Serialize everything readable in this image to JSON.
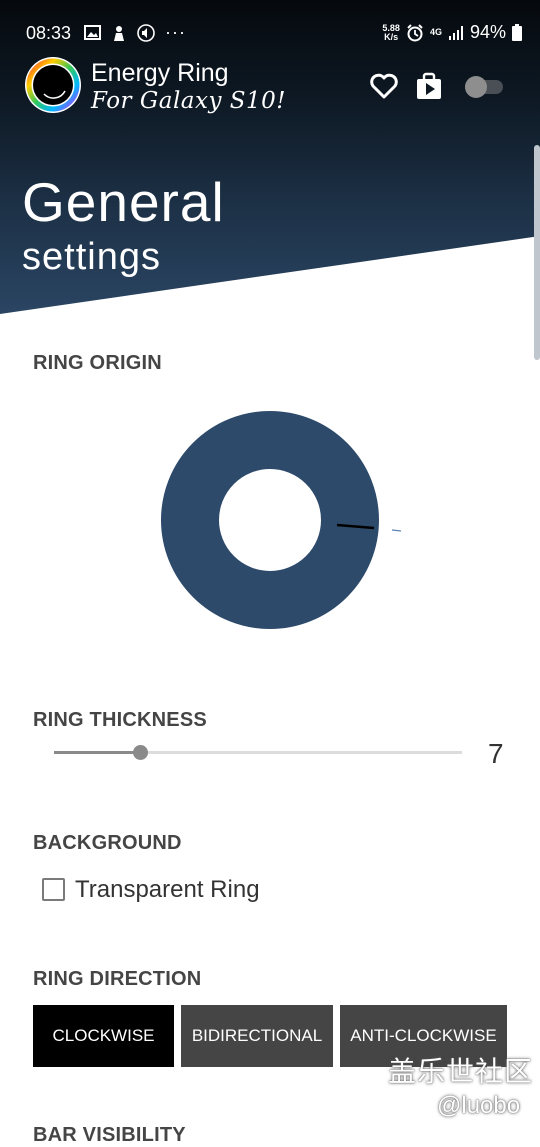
{
  "status_bar": {
    "time": "08:33",
    "net_speed_value": "5.88",
    "net_speed_unit": "K/s",
    "network": "4G",
    "battery": "94%"
  },
  "app": {
    "title": "Energy Ring",
    "subtitle": "For Galaxy S10!"
  },
  "page": {
    "heading": "General",
    "subheading": "settings"
  },
  "sections": {
    "ring_origin": {
      "title": "RING ORIGIN"
    },
    "ring_thickness": {
      "title": "RING THICKNESS",
      "value": "7",
      "slider_fraction": 0.21
    },
    "background": {
      "title": "BACKGROUND",
      "checkbox_label": "Transparent Ring",
      "checked": false
    },
    "ring_direction": {
      "title": "RING DIRECTION",
      "options": [
        "CLOCKWISE",
        "BIDIRECTIONAL",
        "ANTI-CLOCKWISE"
      ],
      "selected": "CLOCKWISE"
    },
    "bar_visibility": {
      "title": "BAR VISIBILITY"
    }
  },
  "watermark": {
    "line1": "盖乐世社区",
    "line2": "@luobo"
  },
  "colors": {
    "ring": "#2d4a6b",
    "header_gradient_end": "#2b4664",
    "button_active": "#000000",
    "button_inactive": "#454545"
  }
}
